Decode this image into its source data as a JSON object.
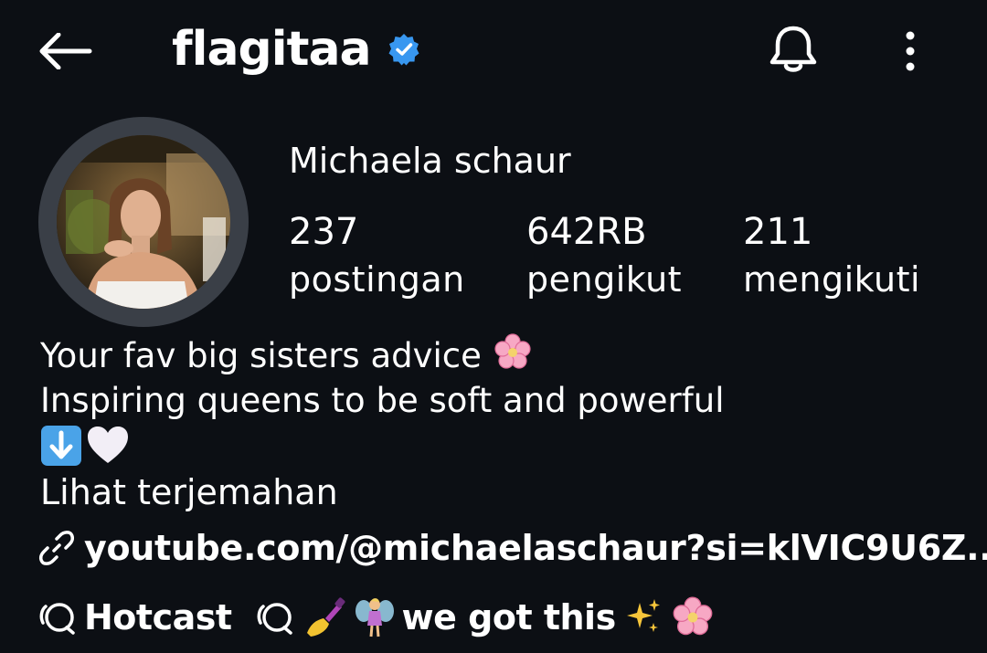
{
  "header": {
    "username": "flagitaa",
    "back_icon": "arrow-left-icon",
    "verified_icon": "verified-badge-icon",
    "bell_icon": "bell-icon",
    "more_icon": "more-vertical-icon",
    "verified_color": "#3897f0"
  },
  "profile": {
    "full_name": "Michaela schaur",
    "stats": [
      {
        "value": "237",
        "label": "postingan"
      },
      {
        "value": "642RB",
        "label": "pengikut"
      },
      {
        "value": "211",
        "label": "mengikuti"
      }
    ]
  },
  "bio": {
    "line1": "Your fav big sisters advice",
    "line2": "Inspiring queens to be soft and powerful",
    "line3_emoji": [
      "down-arrow-emoji",
      "white-heart-emoji"
    ],
    "translate": "Lihat terjemahan"
  },
  "link": {
    "text": "youtube.com/@michaelaschaur?si=klVIC9U6Z..."
  },
  "threads": [
    {
      "label": "Hotcast"
    },
    {
      "label": "we got this"
    }
  ]
}
